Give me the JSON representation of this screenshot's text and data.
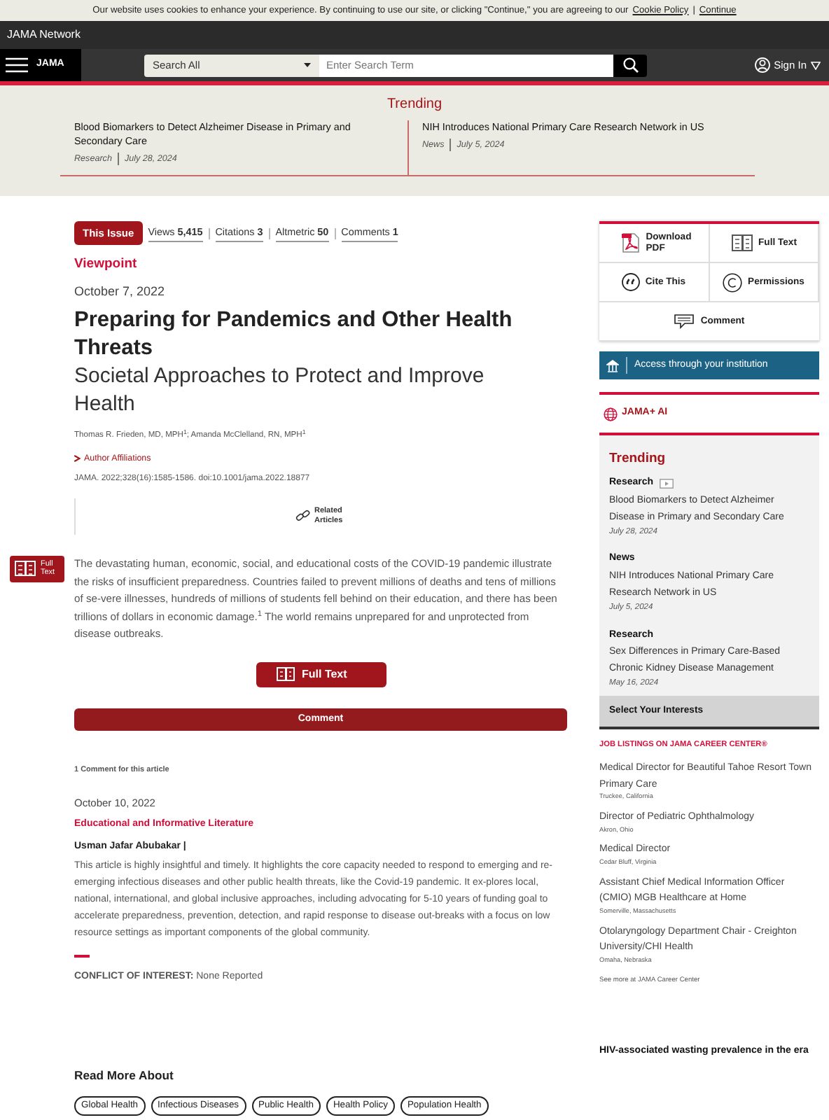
{
  "cookie_bar": {
    "text": "Our website uses cookies to enhance your experience. By continuing to use our site, or clicking \"Continue,\" you are agreeing to our",
    "links": [
      "Cookie Policy",
      "Continue"
    ],
    "separator": "|"
  },
  "header": {
    "network": "JAMA Network",
    "logo": "JAMA",
    "search_scope": "Search All",
    "search_placeholder": "Enter Search Term",
    "sign_in": "Sign In"
  },
  "trending_banner": {
    "title": "Trending",
    "items": [
      {
        "title": "Blood Biomarkers to Detect Alzheimer Disease in Primary and Secondary Care",
        "type": "Research",
        "date": "July 28, 2024"
      },
      {
        "title": "NIH Introduces National Primary Care Research Network in US",
        "type": "News",
        "date": "July 5, 2024"
      }
    ]
  },
  "article": {
    "badge": "This Issue",
    "metrics": [
      {
        "label": "Views",
        "value": "5,415"
      },
      {
        "label": "Citations",
        "value": "3"
      },
      {
        "label": "Altmetric",
        "value": "50"
      },
      {
        "label": "Comments",
        "value": "1"
      }
    ],
    "section": "Viewpoint",
    "date": "October 7, 2022",
    "title": "Preparing for Pandemics and Other Health Threats",
    "subtitle": "Societal Approaches to Protect and Improve Health",
    "authors": "Thomas R. Frieden, MD, MPH$^{1}$; Amanda McClelland, RN, MPH$^{1}$",
    "affiliations": "Author Affiliations",
    "citation": "JAMA. 2022;328(16):1585-1586. doi:10.1001/jama.2022.18877",
    "related": "Related Articles",
    "float_tab": "Full Text",
    "abstract": "The devastating human, economic, social, and educational costs of the COVID-19 pandemic illustrate the risks of insufficient preparedness. Countries failed to prevent millions of deaths and tens of millions of se-vere illnesses, hundreds of millions of students fell behind on their education, and there has been trillions of dollars in economic damage.$^{1}$ The world remains unprepared for and unprotected from disease outbreaks.",
    "full_text_button": "Full Text",
    "comment_button": "Comment",
    "comment_count": "1 Comment for this article",
    "comment": {
      "date": "October 10, 2022",
      "heading": "Educational and Informative Literature",
      "author": "Usman Jafar Abubakar |",
      "body": "This article is highly insightful and timely. It highlights the core capacity needed to respond to emerging and re-emerging infectious diseases and other public health threats, like the Covid-19 pandemic. It ex-plores local, national, international, and global inclusive approaches, including advocating for 5-10 years of funding goal to accelerate preparedness, prevention, detection, and rapid response to disease out-breaks with a focus on low resource settings as important components of the global community.",
      "conflict": "**CONFLICT OF INTEREST:** None Reported"
    },
    "read_more": {
      "title": "Read More About",
      "tags": [
        "Global Health",
        "Infectious Diseases",
        "Public Health",
        "Health Policy",
        "Population Health"
      ]
    }
  },
  "sidebar": {
    "actions": [
      {
        "label": "Download PDF",
        "kind": "pdf"
      },
      {
        "label": "Full Text",
        "kind": "book"
      },
      {
        "label": "Cite This",
        "kind": "quote"
      },
      {
        "label": "Permissions",
        "kind": "copyright"
      },
      {
        "label": "Comment",
        "kind": "comment"
      }
    ],
    "access": "Access through your institution",
    "jama_ai": "JAMA+ AI",
    "trending": {
      "title": "Trending",
      "items": [
        {
          "type": "Research",
          "video": true,
          "title": "Blood Biomarkers to Detect Alzheimer Disease in Primary and Secondary Care",
          "date": "July 28, 2024"
        },
        {
          "type": "News",
          "video": false,
          "title": "NIH Introduces National Primary Care Research Network in US",
          "date": "July 5, 2024"
        },
        {
          "type": "Research",
          "video": false,
          "title": "Sex Differences in Primary Care-Based Chronic Kidney Disease Management",
          "date": "May 16, 2024"
        }
      ]
    },
    "interests": "Select Your Interests",
    "jobs": {
      "title": "JOB LISTINGS ON JAMA CAREER CENTER®",
      "items": [
        {
          "title": "Medical Director for Beautiful Tahoe Resort Town Primary Care",
          "location": "Truckee, California"
        },
        {
          "title": "Director of Pediatric Ophthalmology",
          "location": "Akron, Ohio"
        },
        {
          "title": "Medical Director",
          "location": "Cedar Bluff, Virginia"
        },
        {
          "title": "Assistant Chief Medical Information Officer (CMIO) MGB Healthcare at Home",
          "location": "Somerville, Massachusetts"
        },
        {
          "title": "Otolaryngology Department Chair - Creighton University/CHI Health",
          "location": "Omaha, Nebraska"
        }
      ],
      "more": "See more at JAMA Career Center"
    },
    "teaser": "HIV-associated wasting prevalence in the era"
  }
}
